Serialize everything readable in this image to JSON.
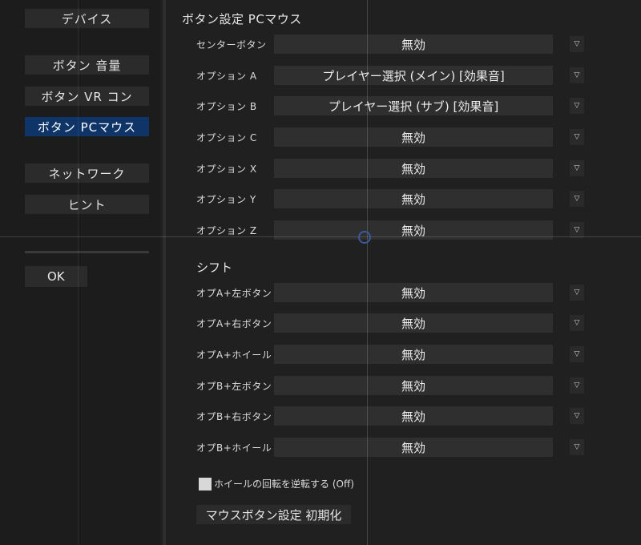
{
  "sidebar": {
    "items": [
      {
        "label": "デバイス",
        "active": false
      },
      {
        "label": "ボタン 音量",
        "active": false
      },
      {
        "label": "ボタン VR コン",
        "active": false
      },
      {
        "label": "ボタン PCマウス",
        "active": true
      },
      {
        "label": "ネットワーク",
        "active": false
      },
      {
        "label": "ヒント",
        "active": false
      }
    ],
    "ok_label": "OK"
  },
  "panel": {
    "title": "ボタン設定 PCマウス",
    "rows": [
      {
        "label": "センターボタン",
        "value": "無効"
      },
      {
        "label": "オプション A",
        "value": "プレイヤー選択 (メイン) [効果音]"
      },
      {
        "label": "オプション B",
        "value": "プレイヤー選択 (サブ) [効果音]"
      },
      {
        "label": "オプション C",
        "value": "無効"
      },
      {
        "label": "オプション X",
        "value": "無効"
      },
      {
        "label": "オプション Y",
        "value": "無効"
      },
      {
        "label": "オプション Z",
        "value": "無効"
      }
    ],
    "shift_title": "シフト",
    "shift_rows": [
      {
        "label": "オプA+左ボタン",
        "value": "無効"
      },
      {
        "label": "オプA+右ボタン",
        "value": "無効"
      },
      {
        "label": "オプA+ホイール",
        "value": "無効"
      },
      {
        "label": "オプB+左ボタン",
        "value": "無効"
      },
      {
        "label": "オプB+右ボタン",
        "value": "無効"
      },
      {
        "label": "オプB+ホイール",
        "value": "無効"
      }
    ],
    "arrow_glyph": "▽",
    "invert_wheel_label": "ホイールの回転を逆転する (Off)",
    "invert_wheel_checked": false,
    "reset_label": "マウスボタン設定 初期化"
  },
  "colors": {
    "background": "#202020",
    "active": "#0e3468",
    "field": "#2f2f2f"
  }
}
